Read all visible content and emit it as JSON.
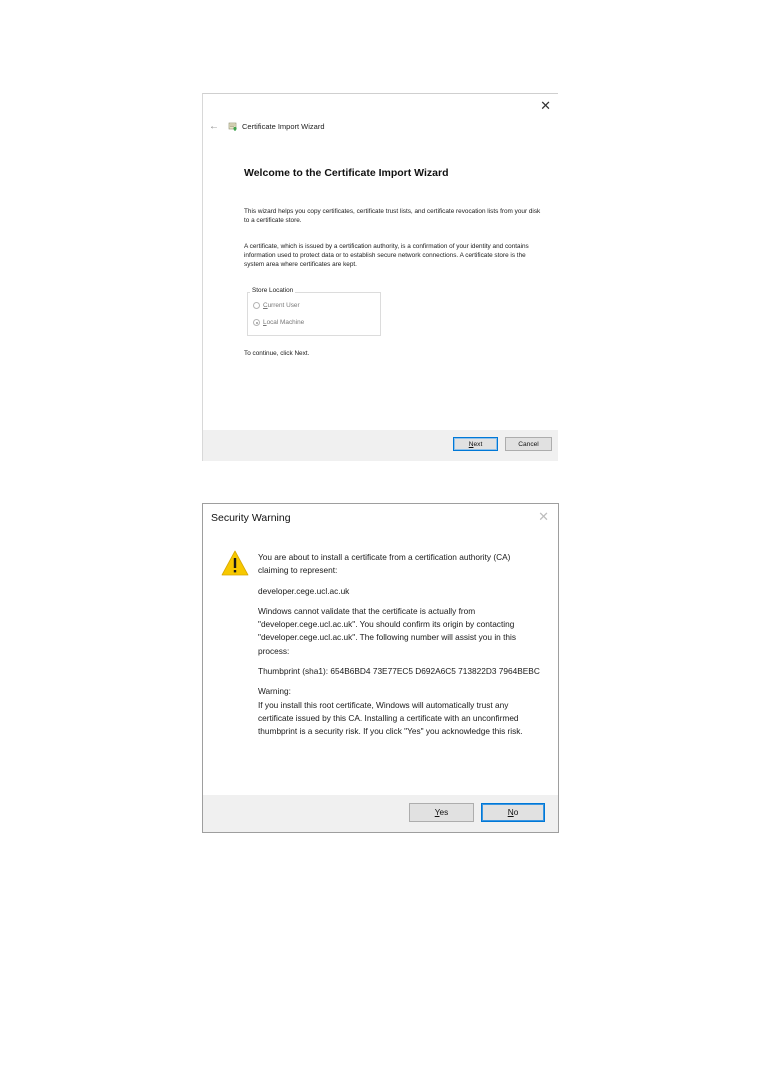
{
  "wizard": {
    "title": "Certificate Import Wizard",
    "heading": "Welcome to the Certificate Import Wizard",
    "paragraph1": "This wizard helps you copy certificates, certificate trust lists, and certificate revocation lists from your disk to a certificate store.",
    "paragraph2": "A certificate, which is issued by a certification authority, is a confirmation of your identity and contains information used to protect data or to establish secure network connections. A certificate store is the system area where certificates are kept.",
    "store_location_label": "Store Location",
    "store_options": [
      {
        "label": "Current User",
        "selected": false
      },
      {
        "label": "Local Machine",
        "selected": true
      }
    ],
    "continue_text": "To continue, click Next.",
    "next_button": "Next",
    "cancel_button": "Cancel",
    "close_glyph": "✕",
    "back_glyph": "←"
  },
  "security_warning": {
    "title": "Security Warning",
    "close_glyph": "✕",
    "intro": "You are about to install a certificate from a certification authority (CA) claiming to represent:",
    "domain": "developer.cege.ucl.ac.uk",
    "validation_text": "Windows cannot validate that the certificate is actually from \"developer.cege.ucl.ac.uk\". You should confirm its origin by contacting \"developer.cege.ucl.ac.uk\". The following number will assist you in this process:",
    "thumbprint": "Thumbprint (sha1): 654B6BD4 73E77EC5 D692A6C5 713822D3 7964BEBC",
    "warning_label": "Warning:",
    "warning_text": "If you install this root certificate, Windows will automatically trust any certificate issued by this CA. Installing a certificate with an unconfirmed thumbprint is a security risk. If you click \"Yes\" you acknowledge this risk.",
    "yes_button": "Yes",
    "no_button": "No"
  },
  "colors": {
    "accent": "#0078d7",
    "warning_yellow": "#f7c800",
    "footer_bg": "#f0f0f0"
  }
}
